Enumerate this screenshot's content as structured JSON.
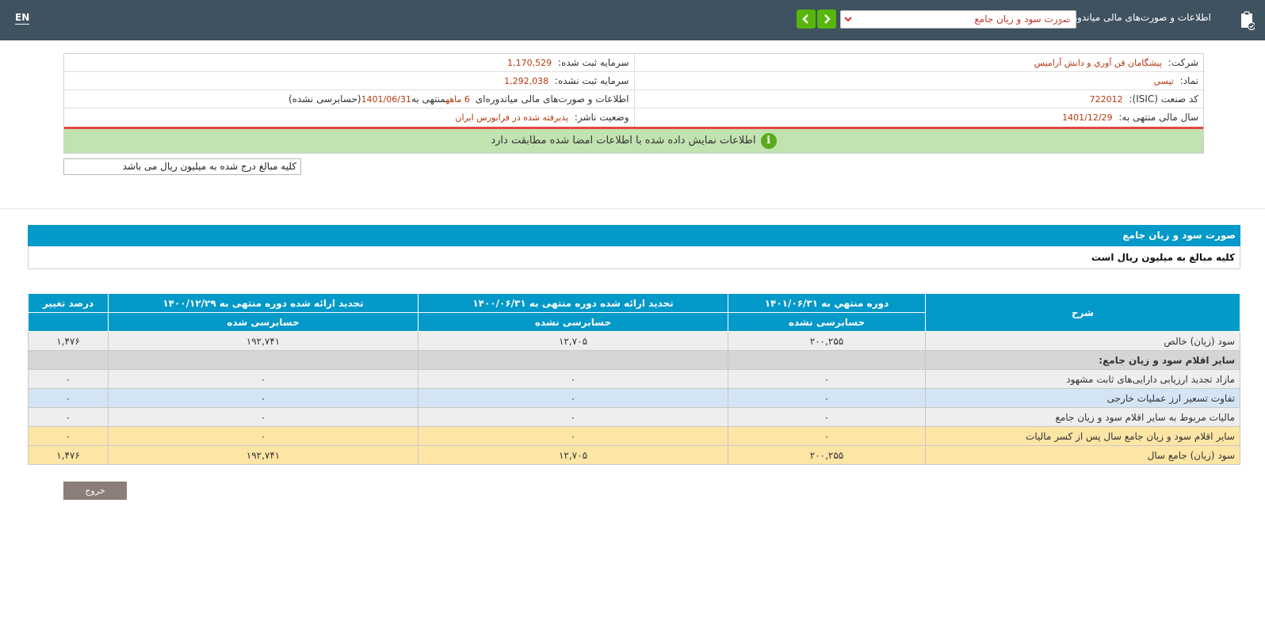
{
  "topbar": {
    "lang": "EN",
    "title": "اطلاعات و صورت‌های مالی میاندوره‌ای",
    "report_select": "صورت سود و زیان جامع",
    "doc_icon": "clipboard-check-icon",
    "prev_icon": "chevron-left-icon",
    "next_icon": "chevron-right-icon"
  },
  "info": {
    "company_label": "شرکت:",
    "company_value": "پیشگامان فن آوري و دانش آراميس",
    "capital_registered_label": "سرمایه ثبت شده:",
    "capital_registered_value": "1,170,529",
    "symbol_label": "نماد:",
    "symbol_value": "تپسي",
    "capital_unregistered_label": "سرمایه ثبت نشده:",
    "capital_unregistered_value": "1,292,038",
    "isic_label": "کد صنعت (ISIC):",
    "isic_value": "722012",
    "period_text_a": "اطلاعات و صورت‌های مالی میاندوره‌ای",
    "period_months": "6 ماهه",
    "period_text_b": "منتهی به",
    "period_date": "1401/06/31",
    "period_status": "(حسابرسی نشده)",
    "fiscal_year_label": "سال مالی منتهی به:",
    "fiscal_year_value": "1401/12/29",
    "publisher_status_label": "وضعیت ناشر:",
    "publisher_status_value": "پذیرفته شده در فرابورس ایران",
    "match_notice": "اطلاعات نمایش داده شده با اطلاعات امضا شده مطابقت دارد",
    "info_icon_glyph": "i",
    "amount_note": "کلیه مبالغ درج شده به میلیون ریال می باشد"
  },
  "section": {
    "title": "صورت سود و زیان جامع",
    "subtitle": "کلیه مبالغ به میلیون ریال است"
  },
  "table": {
    "headers": {
      "description": "شرح",
      "col1": "دوره منتهي به ۱۴۰۱/۰۶/۳۱",
      "col1_sub": "حسابرسی نشده",
      "col2": "تجدید ارائه شده دوره منتهی به ۱۴۰۰/۰۶/۳۱",
      "col2_sub": "حسابرسی نشده",
      "col3": "تجدید ارائه شده دوره منتهی به ۱۴۰۰/۱۲/۲۹",
      "col3_sub": "حسابرسی شده",
      "change": "درصد تغییر"
    },
    "rows": [
      {
        "label": "سود (زیان) خالص",
        "c1": "۲۰۰,۲۵۵",
        "c2": "۱۲,۷۰۵",
        "c3": "۱۹۲,۷۴۱",
        "c4": "۱,۴۷۶"
      },
      {
        "label": "سایر اقلام سود و زیان جامع:",
        "c1": "",
        "c2": "",
        "c3": "",
        "c4": ""
      },
      {
        "label": "مازاد تجدید ارزيابی دارایی‌های ثابت مشهود",
        "c1": "۰",
        "c2": "۰",
        "c3": "۰",
        "c4": "۰"
      },
      {
        "label": "تفاوت تسعیر ارز عملیات خارجی",
        "c1": "۰",
        "c2": "۰",
        "c3": "۰",
        "c4": "۰"
      },
      {
        "label": "مالیات مربوط به سایر اقلام سود و زیان جامع",
        "c1": "۰",
        "c2": "۰",
        "c3": "۰",
        "c4": "۰"
      },
      {
        "label": "سایر اقلام سود و زیان جامع سال پس از کسر مالیات",
        "c1": "۰",
        "c2": "۰",
        "c3": "۰",
        "c4": "۰"
      },
      {
        "label": "سود (زیان) جامع سال",
        "c1": "۲۰۰,۲۵۵",
        "c2": "۱۲,۷۰۵",
        "c3": "۱۹۲,۷۴۱",
        "c4": "۱,۴۷۶"
      }
    ]
  },
  "exit_label": "خروج",
  "colors": {
    "topbar": "#3f525f",
    "accent_blue": "#0399c9",
    "green_button": "#56b70a",
    "notice_green": "#c1e3b0",
    "row_yellow": "#fde5a6",
    "row_blue": "#d3e4f5",
    "value_red": "#b23a10"
  }
}
